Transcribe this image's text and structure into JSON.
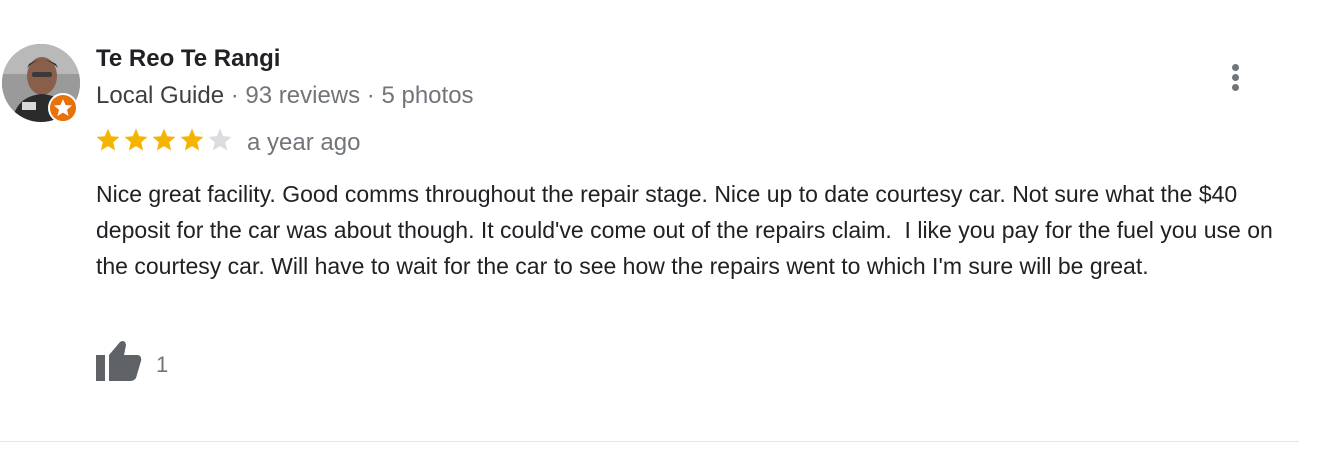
{
  "review": {
    "reviewer": {
      "name": "Te Reo Te Rangi",
      "badge": "Local Guide",
      "reviews_count": "93 reviews",
      "photos_count": "5 photos",
      "separator": " · "
    },
    "rating": 4,
    "rating_max": 5,
    "date": "a year ago",
    "text": "Nice great facility. Good comms throughout the repair stage. Nice up to date courtesy car. Not sure what the $40 deposit for the car was about though. It could've come out of the repairs claim.  I like you pay for the fuel you use on the courtesy car. Will have to wait for the car to see how the repairs went to which I'm sure will be great.",
    "likes": "1",
    "icons": {
      "avatar": "user-avatar",
      "guide_badge": "local-guide-star-icon",
      "more": "more-vertical-icon",
      "like": "thumbs-up-icon"
    },
    "colors": {
      "star_filled": "#f4b400",
      "star_empty": "#dadce0",
      "badge": "#e8710a",
      "muted_text": "#70757a"
    }
  }
}
